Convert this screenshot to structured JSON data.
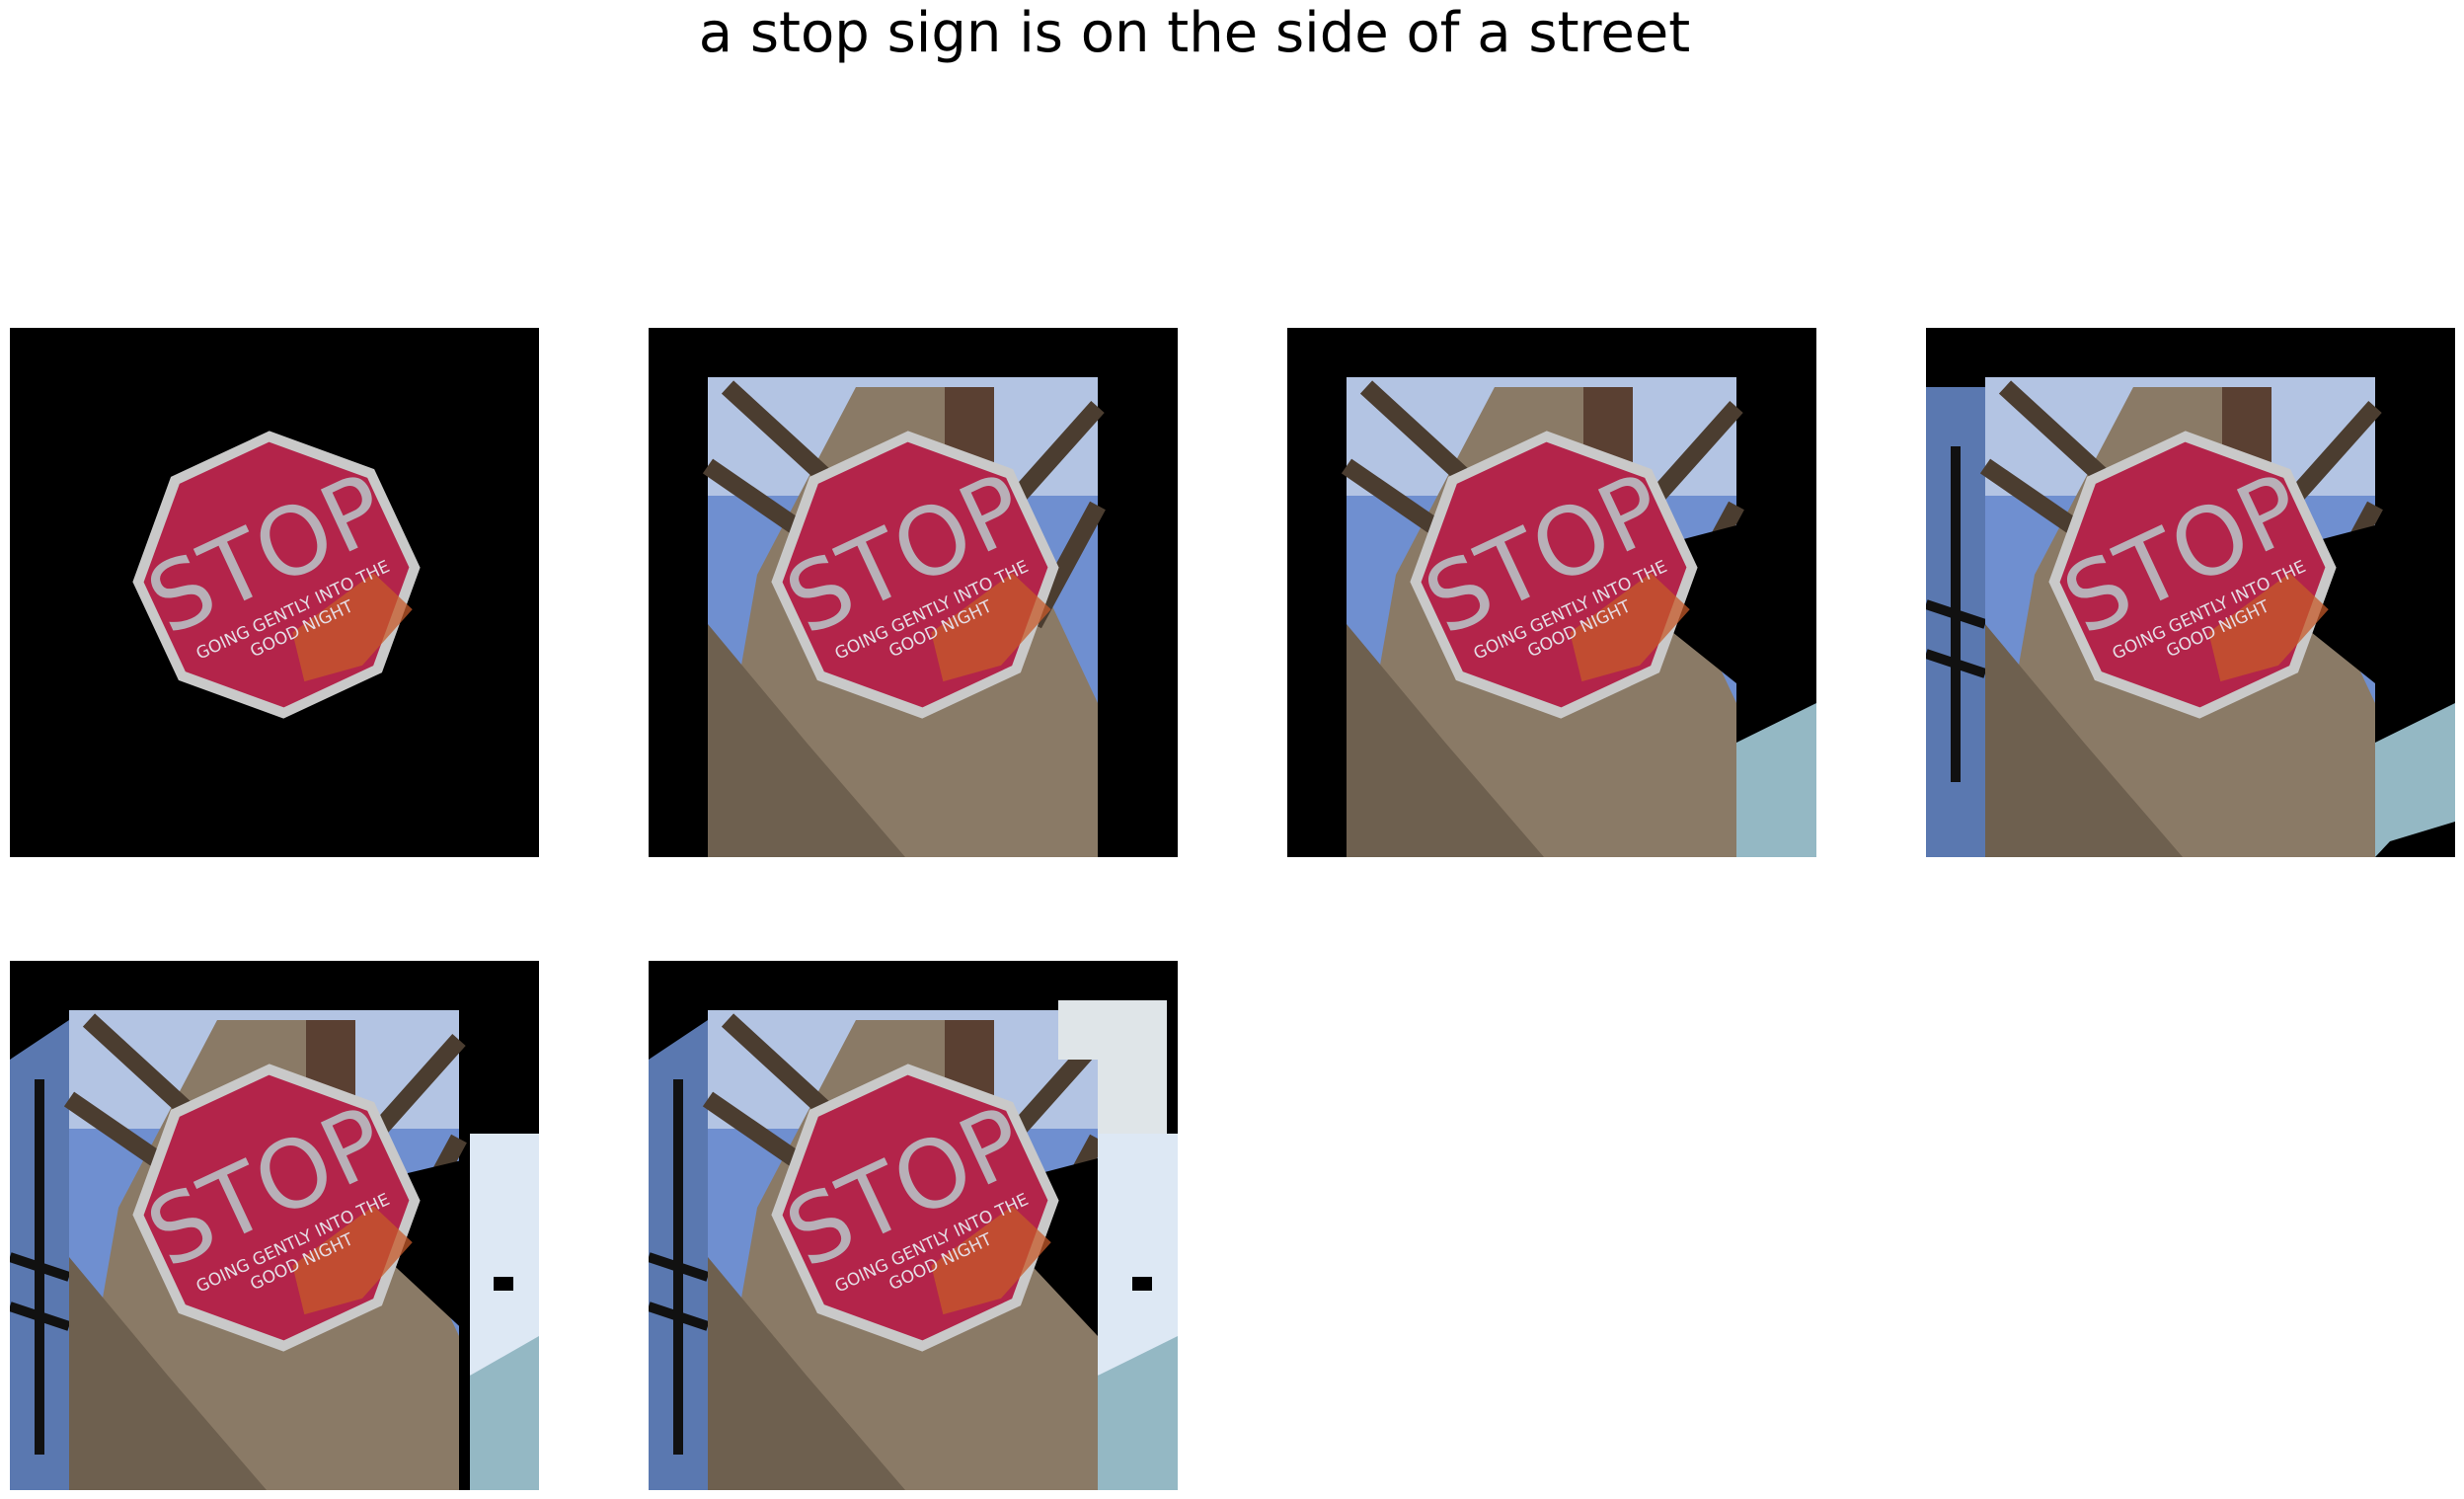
{
  "figure": {
    "caption": "a stop sign is on the side of a street"
  },
  "panels": [
    {
      "step": 1,
      "scene": "sign-only"
    },
    {
      "step": 2,
      "scene": "sign-with-tree"
    },
    {
      "step": 3,
      "scene": "sign-with-tree-and-sky-right"
    },
    {
      "step": 4,
      "scene": "sign-with-tree-pole-left-sky-right"
    },
    {
      "step": 5,
      "scene": "sign-with-tree-pole-left-sky-right-full"
    },
    {
      "step": 6,
      "scene": "sign-with-tree-pole-left-sky-right-top"
    }
  ],
  "sign": {
    "text": "STOP",
    "sticker_line1": "GOING GENTLY INTO THE",
    "sticker_line2": "GOOD NIGHT"
  },
  "colors": {
    "sign_red": "#b3244a",
    "sign_border": "#c9c9c9",
    "bark": "#8a7a66",
    "sky": "#6f8fd0",
    "sky_light": "#dde8f4",
    "teal_sky": "#94b8c4",
    "background": "#000000"
  }
}
